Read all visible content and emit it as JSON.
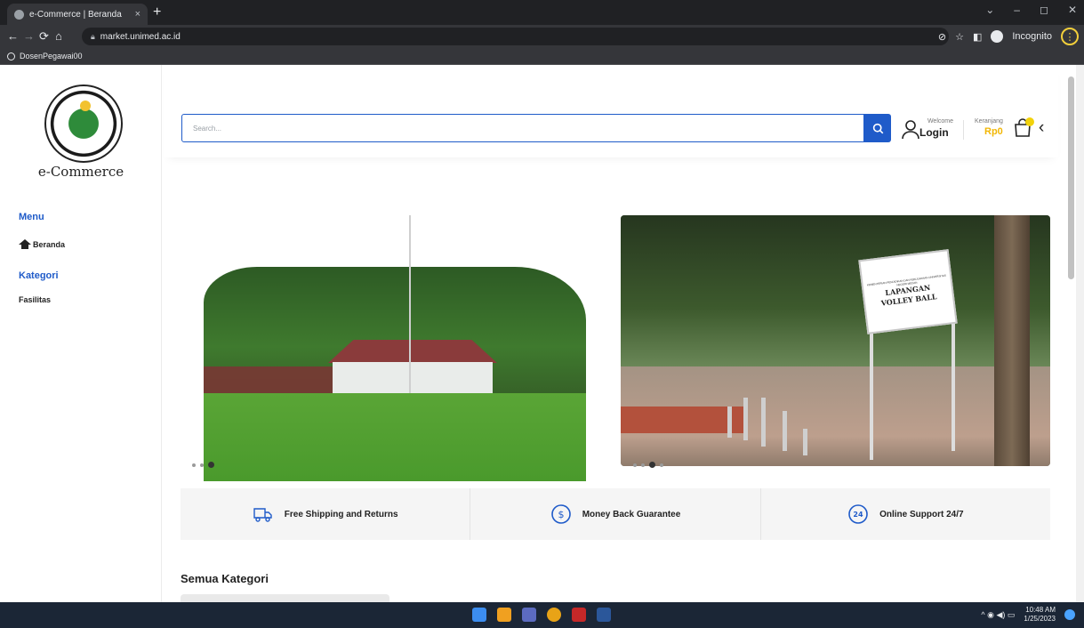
{
  "browser": {
    "tab_title": "e-Commerce | Beranda",
    "tab_close": "×",
    "new_tab": "+",
    "window_controls": [
      "⌄",
      "–",
      "◻",
      "✕"
    ],
    "url": "market.unimed.ac.id",
    "incognito_label": "Incognito",
    "menu_glyph": "⋮",
    "bookmark": "DosenPegawai00"
  },
  "sidebar": {
    "logo_title": "e-Commerce",
    "menu_heading": "Menu",
    "menu_items": [
      {
        "label": "Beranda",
        "icon": "home-icon"
      }
    ],
    "category_heading": "Kategori",
    "category_items": [
      {
        "label": "Fasilitas"
      }
    ]
  },
  "header": {
    "search_placeholder": "Search...",
    "welcome": "Welcome",
    "login": "Login",
    "cart_label": "Keranjang",
    "cart_total": "Rp0",
    "chevron": "‹"
  },
  "slider": {
    "sign_small": "KEMENTERIAN PENDIDIKAN DAN KEBUDAYAAN UNIVERSITAS NEGERI MEDAN",
    "sign_line1": "LAPANGAN",
    "sign_line2": "VOLLEY BALL"
  },
  "features": [
    {
      "label": "Free Shipping and Returns",
      "icon": "truck-icon"
    },
    {
      "label": "Money Back Guarantee",
      "icon": "dollar-circle-icon"
    },
    {
      "label": "Online Support 24/7",
      "icon": "support-24-icon"
    }
  ],
  "section": {
    "title": "Semua Kategori"
  },
  "taskbar": {
    "time": "10:48 AM",
    "date": "1/25/2023",
    "tray_glyphs": "^  ◉  ◀)  ▭"
  },
  "colors": {
    "accent": "#1f5bc9",
    "cart": "#f2b705",
    "taskbar": "#1b2636"
  }
}
